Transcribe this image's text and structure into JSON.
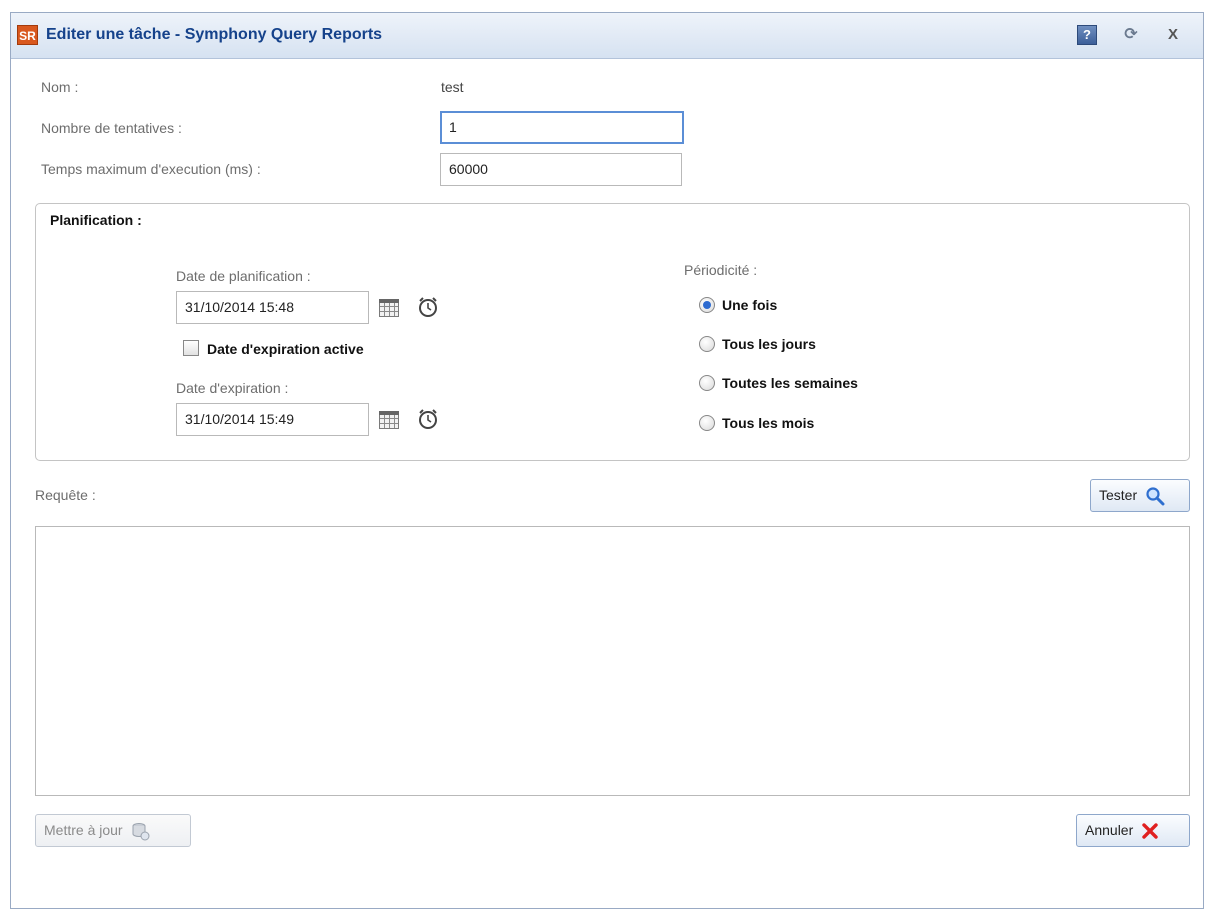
{
  "window": {
    "app_icon_text": "SR",
    "title": "Editer une tâche - Symphony Query Reports",
    "help_label": "?",
    "refresh_label": "⟳",
    "close_label": "X"
  },
  "form": {
    "name_label": "Nom :",
    "name_value": "test",
    "attempts_label": "Nombre de tentatives :",
    "attempts_value": "1",
    "max_time_label": "Temps maximum d'execution (ms) :",
    "max_time_value": "60000"
  },
  "planning": {
    "title": "Planification :",
    "plan_date_label": "Date de planification :",
    "plan_date_value": "31/10/2014 15:48",
    "expiration_active_label": "Date d'expiration active",
    "expiration_active_checked": false,
    "expiration_date_label": "Date d'expiration :",
    "expiration_date_value": "31/10/2014 15:49",
    "periodicity_label": "Périodicité :",
    "periodicity_options": [
      {
        "label": "Une fois",
        "checked": true
      },
      {
        "label": "Tous les jours",
        "checked": false
      },
      {
        "label": "Toutes les semaines",
        "checked": false
      },
      {
        "label": "Tous les mois",
        "checked": false
      }
    ]
  },
  "query": {
    "label": "Requête :",
    "test_button": "Tester",
    "text": ""
  },
  "footer": {
    "update_button": "Mettre à jour",
    "cancel_button": "Annuler"
  },
  "colors": {
    "title_text": "#15428b",
    "radio_checked": "#2d6bd0",
    "cancel_icon": "#e02020"
  }
}
